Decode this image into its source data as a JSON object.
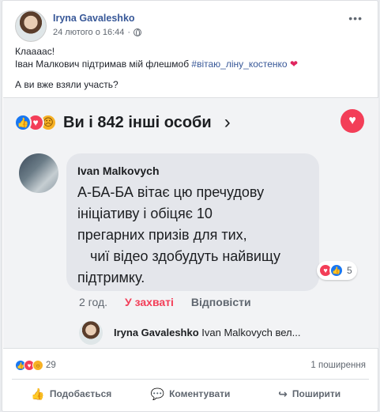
{
  "post": {
    "author": "Iryna Gavaleshko",
    "timestamp": "24 лютого о 16:44",
    "lines": [
      "Клаааас!",
      "Іван Малкович підтримав мій флешмоб",
      "А ви вже взяли участь?"
    ],
    "hashtag": "#вітаю_ліну_костенко",
    "heart": "❤"
  },
  "embed": {
    "reaction_summary": "Ви і 842 інші особи",
    "comment": {
      "author": "Ivan Malkovych",
      "lines": [
        "А-БА-БА вітає цю пречудову",
        "ініціативу і обіцяє 10",
        "прегарних  призів для тих,",
        "чиї відео здобудуть найвищу",
        "підтримку."
      ],
      "reaction_count": "5",
      "time": "2 год.",
      "reacted_label": "У захваті",
      "reply_label": "Відповісти"
    },
    "reply": {
      "author": "Iryna Gavaleshko",
      "snippet": "Ivan Malkovych вел..."
    }
  },
  "summary": {
    "reaction_count": "29",
    "shares": "1 поширення"
  },
  "actions": {
    "like": "Подобається",
    "comment": "Коментувати",
    "share": "Поширити"
  },
  "icons": {
    "like": "like-icon",
    "love": "love-icon",
    "sad": "sad-icon",
    "wow": "wow-icon",
    "comment": "comment-icon",
    "share": "share-icon"
  },
  "colors": {
    "link": "#385898",
    "love": "#f33e58",
    "like": "#1877f2"
  }
}
